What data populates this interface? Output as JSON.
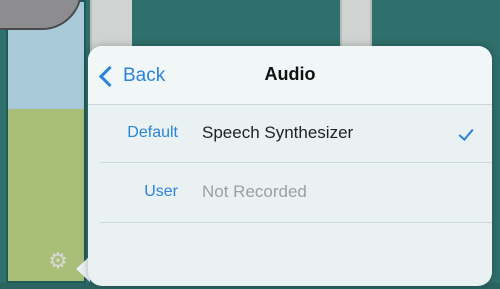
{
  "popover": {
    "back_label": "Back",
    "title": "Audio",
    "rows": [
      {
        "label": "Default",
        "value": "Speech Synthesizer",
        "selected": true
      },
      {
        "label": "User",
        "value": "Not Recorded",
        "selected": false
      }
    ]
  },
  "icons": {
    "back": "chevron-left-icon",
    "check": "checkmark-icon",
    "settings": "gear-icon"
  },
  "colors": {
    "accent": "#2c84d6",
    "background": "#2f6f6c"
  }
}
